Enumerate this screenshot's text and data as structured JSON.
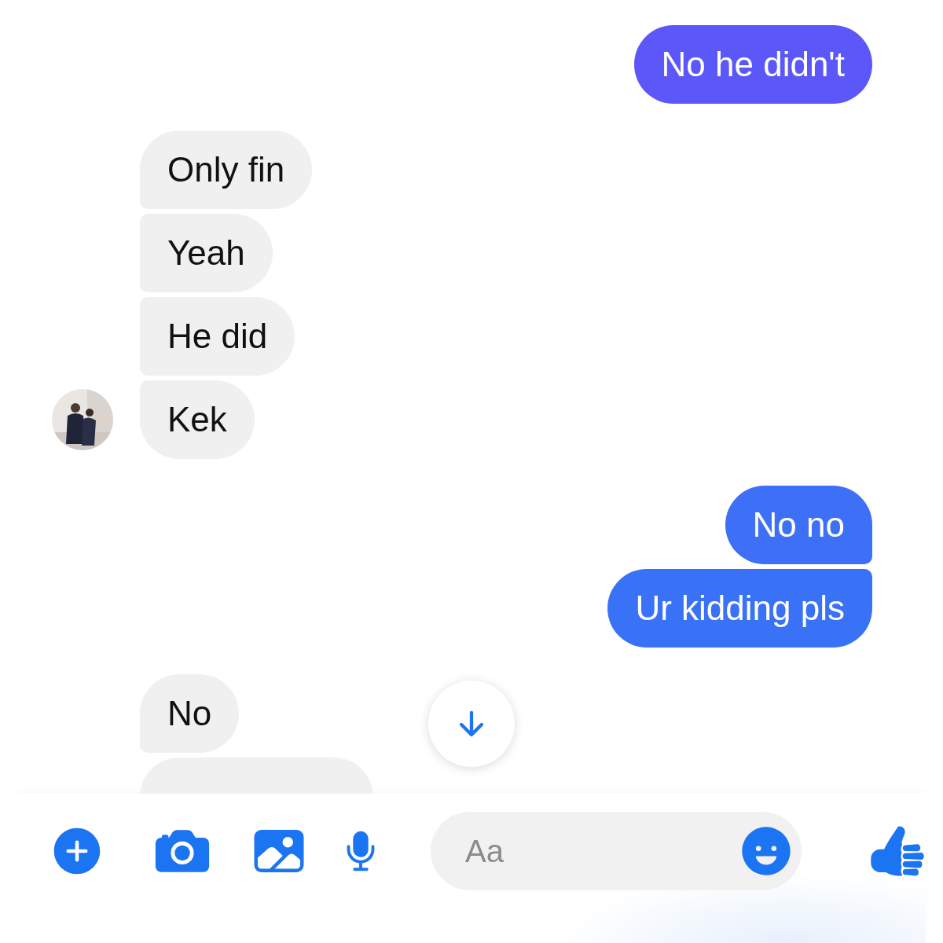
{
  "messages": [
    {
      "kind": "sent",
      "items": [
        {
          "kind": "text",
          "text": "No he didn't",
          "color": "#5b57f8"
        }
      ]
    },
    {
      "kind": "received",
      "avatar": true,
      "items": [
        {
          "kind": "text",
          "text": "Only fin"
        },
        {
          "kind": "text",
          "text": "Yeah"
        },
        {
          "kind": "text",
          "text": "He did"
        },
        {
          "kind": "text",
          "text": "Kek"
        }
      ]
    },
    {
      "kind": "sent",
      "items": [
        {
          "kind": "text",
          "text": "No no",
          "color": "#3d6ff7"
        },
        {
          "kind": "text",
          "text": "Ur kidding pls",
          "color": "#3a72f7"
        }
      ]
    },
    {
      "kind": "received",
      "avatar": false,
      "items": [
        {
          "kind": "text",
          "text": "No"
        },
        {
          "kind": "partial"
        }
      ]
    }
  ],
  "scroll_down_button": true,
  "composer": {
    "placeholder": "Aa"
  }
}
